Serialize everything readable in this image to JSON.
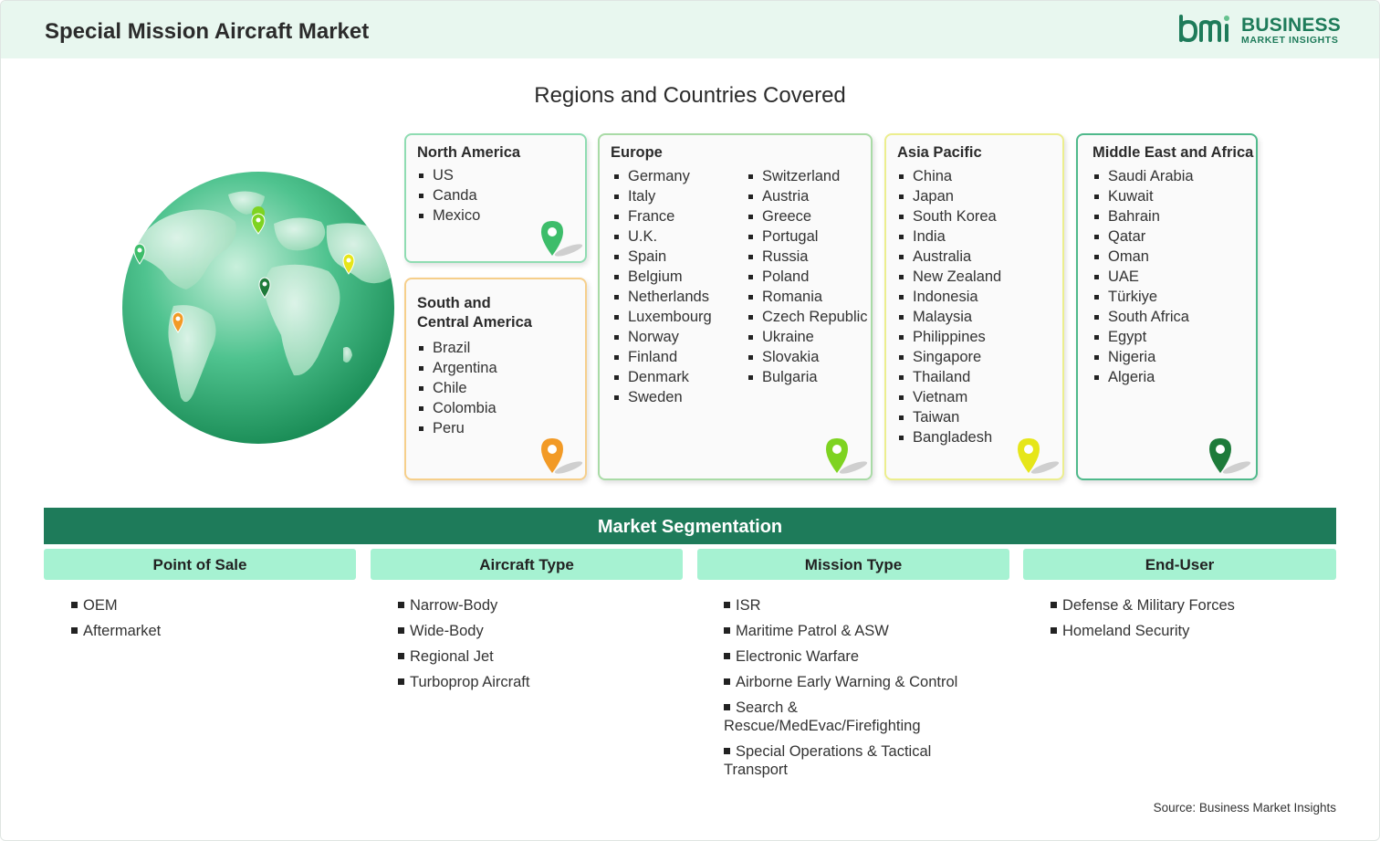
{
  "header": {
    "title": "Special Mission Aircraft Market"
  },
  "logo": {
    "line1": "BUSINESS",
    "line2": "MARKET INSIGHTS",
    "mark_text": "bmi"
  },
  "regions": {
    "title": "Regions and Countries Covered",
    "north_america": {
      "title": "North America",
      "items": [
        "US",
        "Canda",
        "Mexico"
      ],
      "pin_color": "#3dbd6a"
    },
    "south_america": {
      "title_line1": "South and",
      "title_line2": "Central America",
      "items": [
        "Brazil",
        "Argentina",
        "Chile",
        "Colombia",
        "Peru"
      ],
      "pin_color": "#f29a26"
    },
    "europe": {
      "title": "Europe",
      "items_col1": [
        "Germany",
        "Italy",
        "France",
        "U.K.",
        "Spain",
        "Belgium",
        "Netherlands",
        "Luxembourg",
        "Norway",
        "Finland",
        "Denmark",
        "Sweden"
      ],
      "items_col2": [
        "Switzerland",
        "Austria",
        "Greece",
        "Portugal",
        "Russia",
        "Poland",
        "Romania",
        "Czech Republic",
        "Ukraine",
        "Slovakia",
        "Bulgaria"
      ],
      "pin_color": "#7ed321"
    },
    "asia_pacific": {
      "title": "Asia Pacific",
      "items": [
        "China",
        "Japan",
        "South Korea",
        "India",
        "Australia",
        "New Zealand",
        "Indonesia",
        "Malaysia",
        "Philippines",
        "Singapore",
        "Thailand",
        "Vietnam",
        "Taiwan",
        "Bangladesh"
      ],
      "pin_color": "#e6e619"
    },
    "middle_east_africa": {
      "title": "Middle East and Africa",
      "items": [
        "Saudi Arabia",
        "Kuwait",
        "Bahrain",
        "Qatar",
        "Oman",
        "UAE",
        "Türkiye",
        "South Africa",
        "Egypt",
        "Nigeria",
        "Algeria"
      ],
      "pin_color": "#1e7b3a"
    }
  },
  "segmentation": {
    "title": "Market Segmentation",
    "columns": [
      {
        "header": "Point of Sale",
        "items": [
          "OEM",
          "Aftermarket"
        ]
      },
      {
        "header": "Aircraft Type",
        "items": [
          "Narrow-Body",
          "Wide-Body",
          "Regional Jet",
          "Turboprop Aircraft"
        ]
      },
      {
        "header": "Mission Type",
        "items": [
          "ISR",
          "Maritime Patrol & ASW",
          "Electronic Warfare",
          "Airborne Early Warning & Control",
          "Search & Rescue/MedEvac/Firefighting",
          "Special Operations & Tactical Transport"
        ]
      },
      {
        "header": "End-User",
        "items": [
          "Defense & Military Forces",
          "Homeland Security"
        ]
      }
    ]
  },
  "source": "Source: Business Market Insights",
  "colors": {
    "brand_green": "#1e7b5a",
    "header_bg": "#e8f7ef",
    "segment_head_bg": "#a6f2d2"
  },
  "icons": [
    "globe-icon",
    "map-pin-icon",
    "bmi-logo-icon"
  ]
}
